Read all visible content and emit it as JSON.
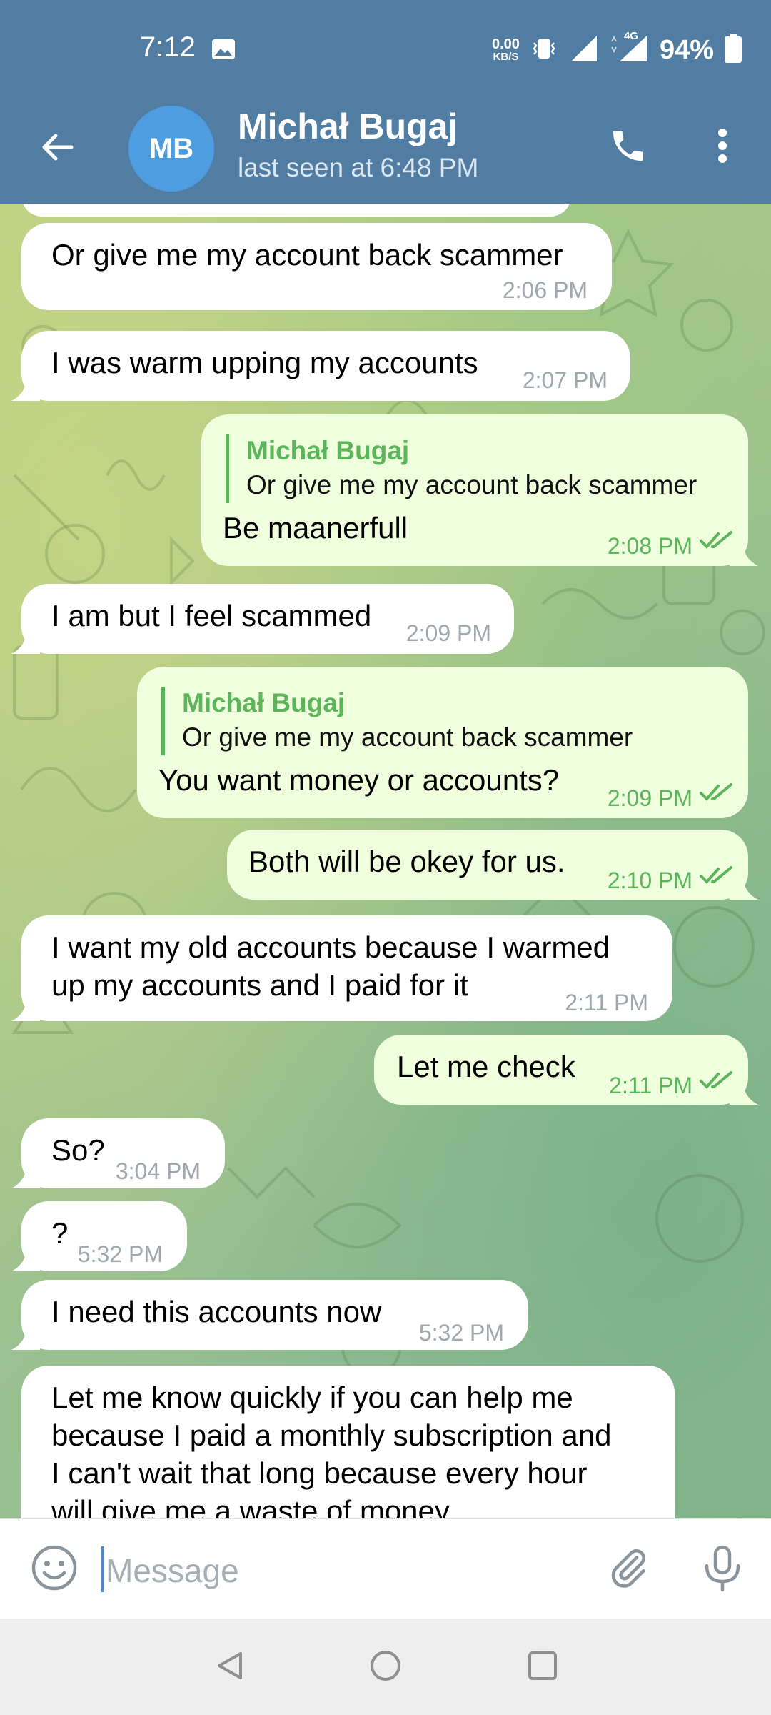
{
  "status_bar": {
    "time": "7:12",
    "net_speed_value": "0.00",
    "net_speed_unit": "KB/S",
    "network_type": "4G",
    "battery": "94%"
  },
  "header": {
    "avatar_initials": "MB",
    "contact_name": "Michał Bugaj",
    "last_seen": "last seen at 6:48 PM",
    "colors": {
      "bar": "#517da2",
      "avatar": "#4d9de0"
    }
  },
  "messages": [
    {
      "direction": "in",
      "text": "Or give me my account back scammer",
      "time": "2:06 PM"
    },
    {
      "direction": "in",
      "text": "I was warm upping my accounts",
      "time": "2:07 PM"
    },
    {
      "direction": "out",
      "reply_to_name": "Michał Bugaj",
      "reply_to_text": "Or give me my account back scammer",
      "text": "Be maanerfull",
      "time": "2:08 PM",
      "status": "read"
    },
    {
      "direction": "in",
      "text": "I am but I feel scammed",
      "time": "2:09 PM"
    },
    {
      "direction": "out",
      "reply_to_name": "Michał Bugaj",
      "reply_to_text": "Or give me my account back scammer",
      "text": "You want money or accounts?",
      "time": "2:09 PM",
      "status": "read"
    },
    {
      "direction": "out",
      "text": "Both will be okey for us.",
      "time": "2:10 PM",
      "status": "read"
    },
    {
      "direction": "in",
      "lines": [
        "I want my old accounts because I warmed",
        "up my accounts and I paid for it"
      ],
      "time": "2:11 PM"
    },
    {
      "direction": "out",
      "text": "Let me check",
      "time": "2:11 PM",
      "status": "read"
    },
    {
      "direction": "in",
      "text": "So?",
      "time": "3:04 PM"
    },
    {
      "direction": "in",
      "text": "?",
      "time": "5:32 PM"
    },
    {
      "direction": "in",
      "text": "I need this accounts now",
      "time": "5:32 PM"
    },
    {
      "direction": "in",
      "lines": [
        "Let me know quickly if you can help me",
        "because I paid a monthly subscription and",
        "I can't wait that long because every hour",
        "will give me a waste of money"
      ],
      "time": ""
    }
  ],
  "input": {
    "placeholder": "Message",
    "value": ""
  },
  "icons": {
    "back": "arrow-left-icon",
    "call": "phone-icon",
    "menu": "more-vertical-icon",
    "emoji": "smiley-icon",
    "attach": "paperclip-icon",
    "mic": "microphone-icon",
    "read_status": "double-check-icon",
    "nav": [
      "nav-back-icon",
      "nav-home-icon",
      "nav-recents-icon"
    ]
  },
  "colors": {
    "incoming_bubble": "#ffffff",
    "outgoing_bubble": "#effedd",
    "outgoing_accent": "#5cb55a"
  }
}
